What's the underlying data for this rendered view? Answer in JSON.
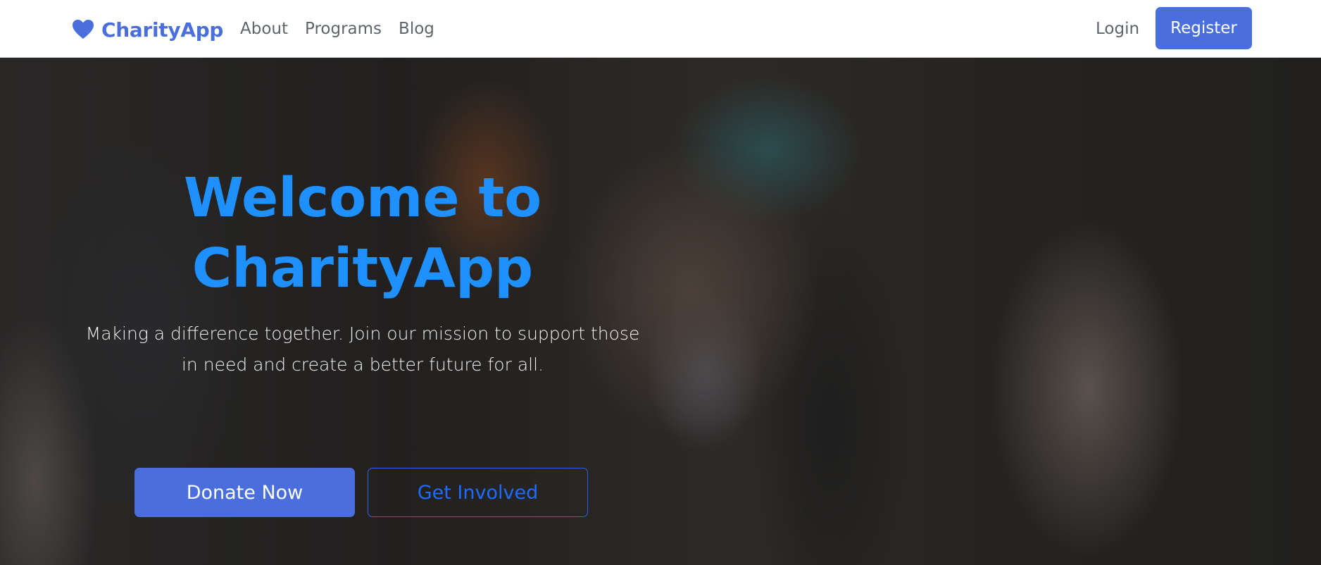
{
  "nav": {
    "brand": "CharityApp",
    "brand_icon": "heart-icon",
    "links": [
      "About",
      "Programs",
      "Blog"
    ],
    "login_label": "Login",
    "register_label": "Register"
  },
  "hero": {
    "title_line1": "Welcome to",
    "title_line2": "CharityApp",
    "subtitle_line1": "Making a difference together. Join our mission to support those",
    "subtitle_line2": "in need and create a better future for all.",
    "primary_button": "Donate Now",
    "secondary_button": "Get Involved"
  },
  "colors": {
    "primary": "#4a6fdc",
    "title_blue": "#1e90ff",
    "nav_text": "#5e646b"
  }
}
